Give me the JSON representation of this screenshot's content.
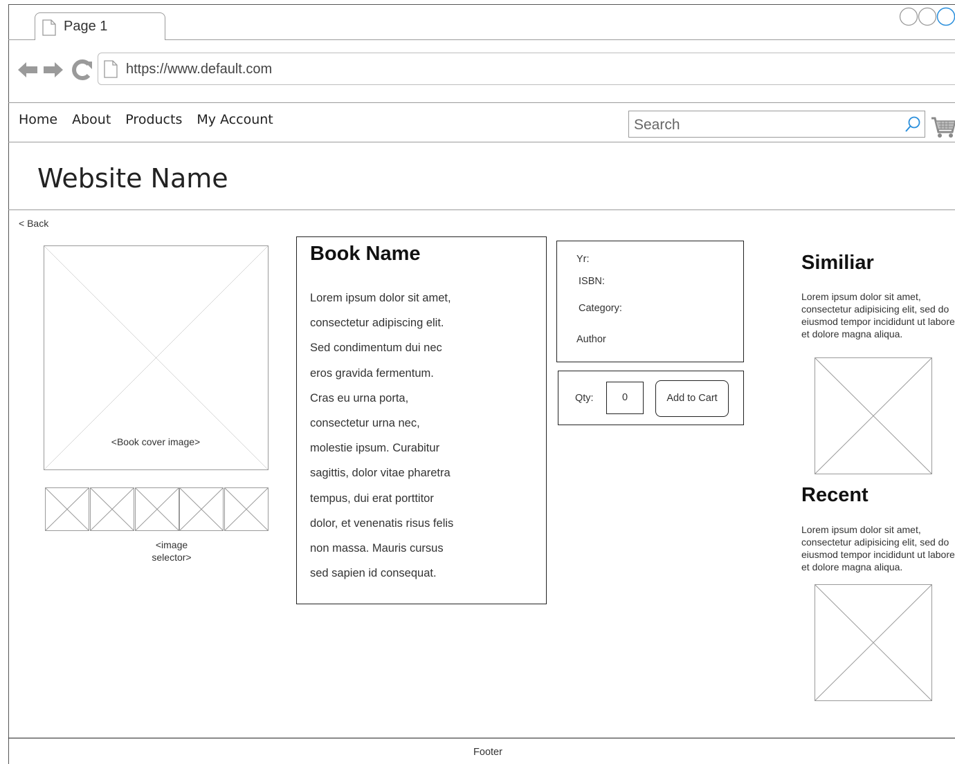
{
  "browser": {
    "tab_label": "Page 1",
    "url": "https://www.default.com"
  },
  "nav": {
    "items": [
      "Home",
      "About",
      "Products",
      "My Account"
    ],
    "search_placeholder": "Search"
  },
  "site": {
    "title": "Website Name",
    "back_label": "< Back"
  },
  "gallery": {
    "cover_caption": "<Book cover image>",
    "selector_caption": "<image selector>",
    "thumbnail_count": 5
  },
  "book": {
    "title": "Book Name",
    "description": "Lorem ipsum dolor sit amet,\nconsectetur adipiscing elit.\nSed condimentum dui nec\neros gravida fermentum.\nCras eu urna porta,\nconsectetur urna nec,\nmolestie ipsum. Curabitur\nsagittis, dolor vitae pharetra\ntempus, dui erat porttitor\ndolor, et venenatis risus felis\nnon massa. Mauris cursus\nsed sapien id consequat."
  },
  "info": {
    "year_label": "Yr:",
    "isbn_label": "ISBN:",
    "category_label": "Category:",
    "author_label": "Author"
  },
  "cart": {
    "qty_label": "Qty:",
    "qty_value": "0",
    "add_label": "Add to Cart"
  },
  "sidebar": {
    "similar_title": "Similiar",
    "similar_text": "Lorem ipsum dolor sit amet, consectetur adipisicing elit, sed do eiusmod tempor incididunt ut labore et dolore magna aliqua.",
    "recent_title": "Recent",
    "recent_text": "Lorem ipsum dolor sit amet, consectetur adipisicing elit, sed do eiusmod tempor incididunt ut labore et dolore magna aliqua."
  },
  "footer": {
    "label": "Footer"
  },
  "icons": {
    "tab": "page-icon",
    "back": "arrow-left-icon",
    "forward": "arrow-right-icon",
    "reload": "reload-icon",
    "search": "search-icon",
    "cart": "cart-icon"
  },
  "colors": {
    "window_circle_accent": "#2a8fdc",
    "stroke": "#9a9a9a"
  }
}
